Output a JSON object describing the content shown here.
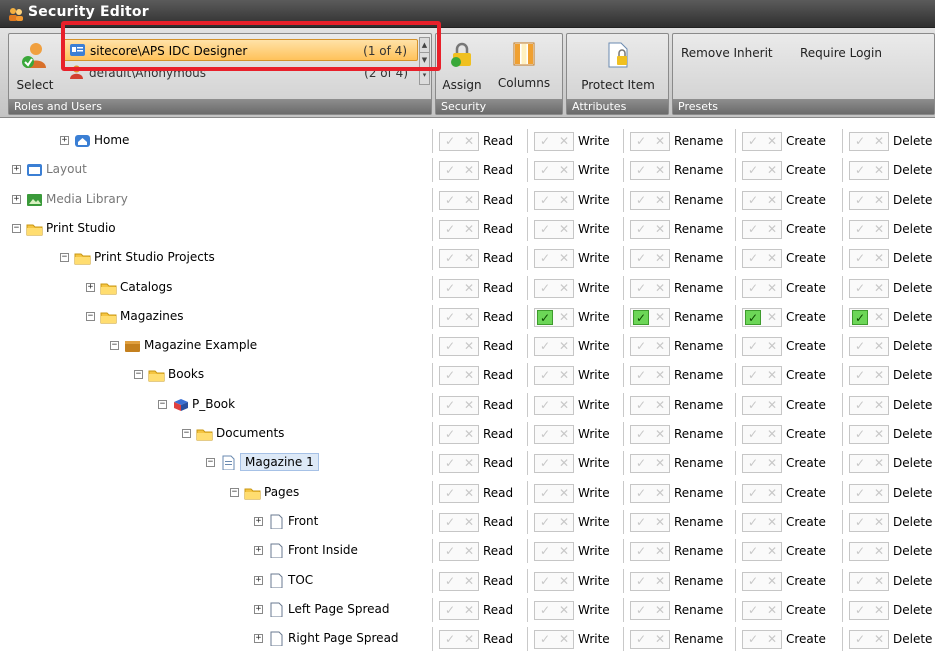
{
  "window": {
    "title": "Security Editor"
  },
  "ribbon": {
    "roles_group": {
      "caption": "Roles and Users",
      "select_label": "Select",
      "roles": [
        {
          "name": "sitecore\\APS IDC Designer",
          "count": "(1 of 4)"
        },
        {
          "name": "default\\Anonymous",
          "count": "(2 of 4)"
        }
      ]
    },
    "security_group": {
      "caption": "Security",
      "assign_label": "Assign",
      "columns_label": "Columns"
    },
    "attributes_group": {
      "caption": "Attributes",
      "protect_label": "Protect Item"
    },
    "presets_group": {
      "caption": "Presets",
      "remove_inherit_label": "Remove Inherit",
      "require_login_label": "Require Login"
    }
  },
  "permission_labels": [
    "Read",
    "Write",
    "Rename",
    "Create",
    "Delete"
  ],
  "tree": [
    {
      "label": "Home",
      "expander": "+",
      "icon": "home-icon",
      "indent": 0,
      "grey": false,
      "allowed": []
    },
    {
      "label": "Layout",
      "expander": "+",
      "icon": "layout-icon",
      "indent": -1,
      "grey": true,
      "allowed": []
    },
    {
      "label": "Media Library",
      "expander": "+",
      "icon": "media-library-icon",
      "indent": -1,
      "grey": true,
      "allowed": []
    },
    {
      "label": "Print Studio",
      "expander": "-",
      "icon": "folder-icon",
      "indent": -1,
      "grey": false,
      "allowed": []
    },
    {
      "label": "Print Studio Projects",
      "expander": "-",
      "icon": "folder-icon",
      "indent": 0,
      "grey": false,
      "allowed": []
    },
    {
      "label": "Catalogs",
      "expander": "+",
      "icon": "folder-icon",
      "indent": 1,
      "grey": false,
      "allowed": []
    },
    {
      "label": "Magazines",
      "expander": "-",
      "icon": "folder-icon",
      "indent": 1,
      "grey": false,
      "allowed": [
        "Write",
        "Rename",
        "Create",
        "Delete"
      ]
    },
    {
      "label": "Magazine Example",
      "expander": "-",
      "icon": "magazine-icon",
      "indent": 2,
      "grey": false,
      "allowed": []
    },
    {
      "label": "Books",
      "expander": "-",
      "icon": "folder-icon",
      "indent": 3,
      "grey": false,
      "allowed": []
    },
    {
      "label": "P_Book",
      "expander": "-",
      "icon": "book-icon",
      "indent": 4,
      "grey": false,
      "allowed": []
    },
    {
      "label": "Documents",
      "expander": "-",
      "icon": "folder-icon",
      "indent": 5,
      "grey": false,
      "allowed": []
    },
    {
      "label": "Magazine 1",
      "expander": "-",
      "icon": "document-icon",
      "indent": 6,
      "grey": false,
      "selected": true,
      "allowed": []
    },
    {
      "label": "Pages",
      "expander": "-",
      "icon": "folder-icon",
      "indent": 7,
      "grey": false,
      "allowed": []
    },
    {
      "label": "Front",
      "expander": "+",
      "icon": "page-icon",
      "indent": 8,
      "grey": false,
      "allowed": []
    },
    {
      "label": "Front Inside",
      "expander": "+",
      "icon": "page-icon",
      "indent": 8,
      "grey": false,
      "allowed": []
    },
    {
      "label": "TOC",
      "expander": "+",
      "icon": "page-icon",
      "indent": 8,
      "grey": false,
      "allowed": []
    },
    {
      "label": "Left Page Spread",
      "expander": "+",
      "icon": "page-icon",
      "indent": 8,
      "grey": false,
      "allowed": []
    },
    {
      "label": "Right Page Spread",
      "expander": "+",
      "icon": "page-icon",
      "indent": 8,
      "grey": false,
      "allowed": []
    }
  ]
}
